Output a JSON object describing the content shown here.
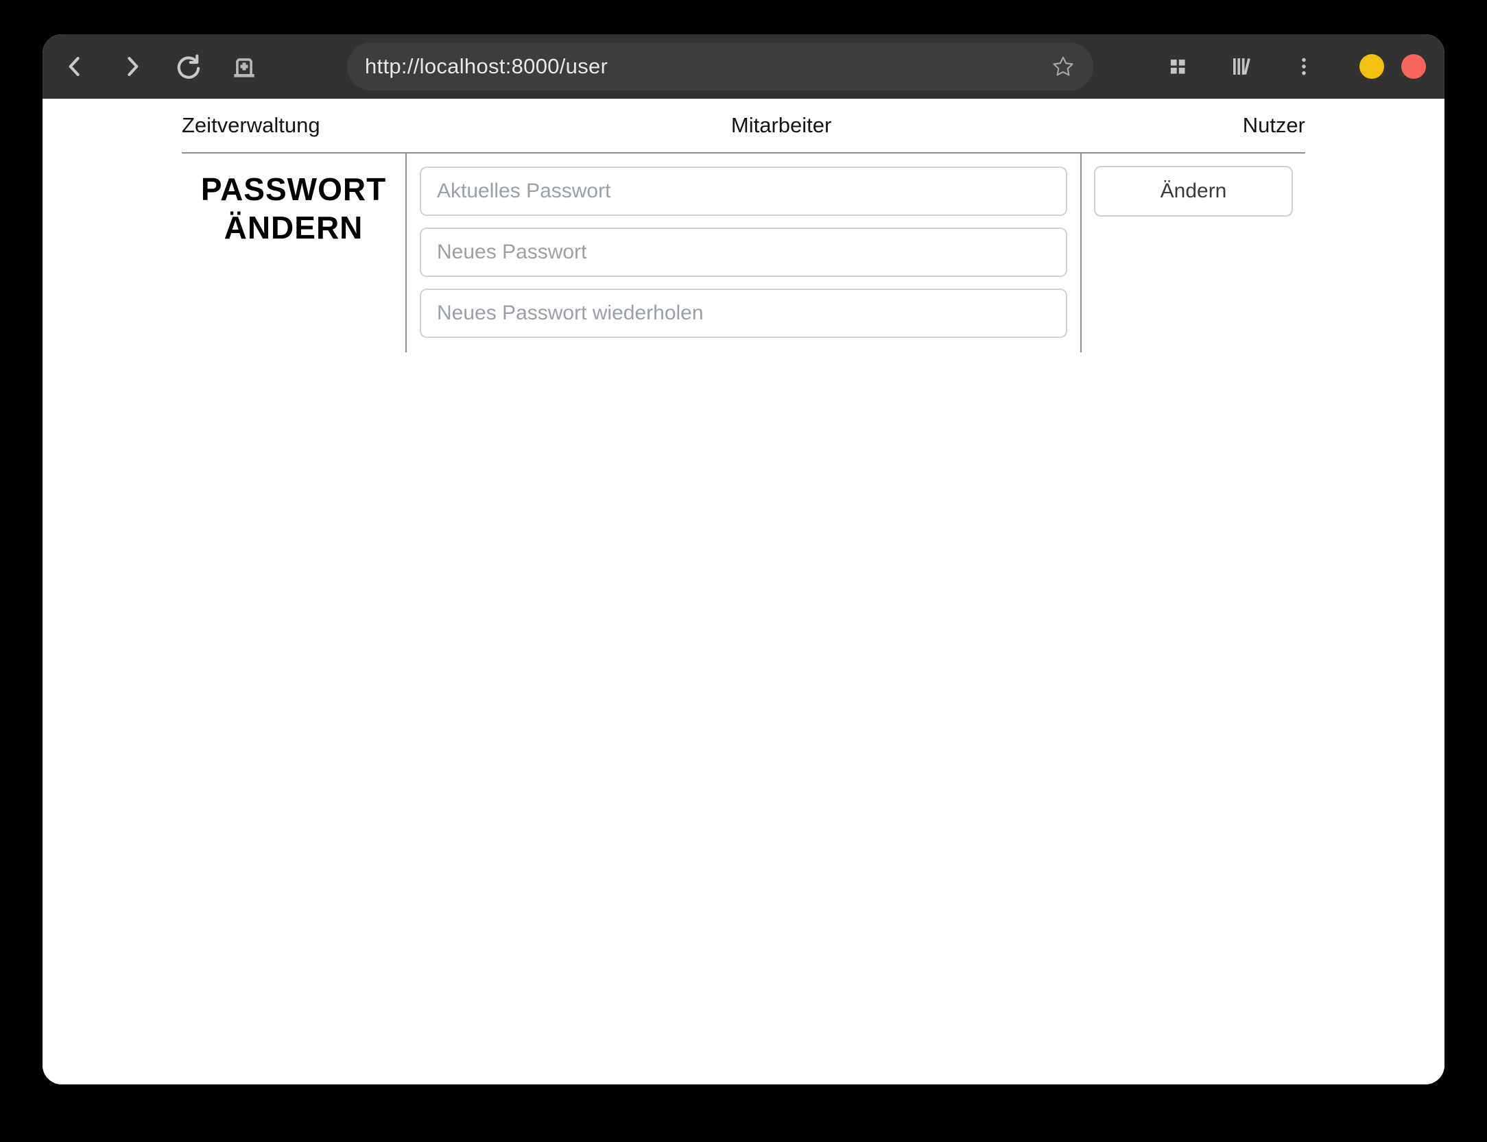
{
  "browser": {
    "url": "http://localhost:8000/user",
    "icons": [
      "back-icon",
      "forward-icon",
      "reload-icon",
      "new-tab-icon",
      "bookmark-star-icon",
      "apps-grid-icon",
      "library-icon",
      "menu-kebab-icon",
      "minimize-button",
      "close-button"
    ]
  },
  "nav": {
    "items": [
      {
        "label": "Zeitverwaltung"
      },
      {
        "label": "Mitarbeiter"
      },
      {
        "label": "Nutzer"
      }
    ]
  },
  "main": {
    "heading": {
      "line1": "PASSWORT",
      "line2": "ÄNDERN"
    },
    "form": {
      "fields": [
        {
          "name": "current-password",
          "placeholder": "Aktuelles Passwort",
          "value": ""
        },
        {
          "name": "new-password",
          "placeholder": "Neues Passwort",
          "value": ""
        },
        {
          "name": "repeat-password",
          "placeholder": "Neues Passwort wiederholen",
          "value": ""
        }
      ],
      "submit_label": "Ändern"
    }
  },
  "colors": {
    "outer_bg": "#000000",
    "toolbar_bg": "#323232",
    "urlbar_bg": "#3d3d3d",
    "window_bg": "#ffffff",
    "divider_gray": "#8f8f8f",
    "input_border": "#d2d2d2",
    "placeholder_gray": "#9aa0a6",
    "minimize_yellow": "#f2c00e",
    "close_red": "#f5655b"
  }
}
